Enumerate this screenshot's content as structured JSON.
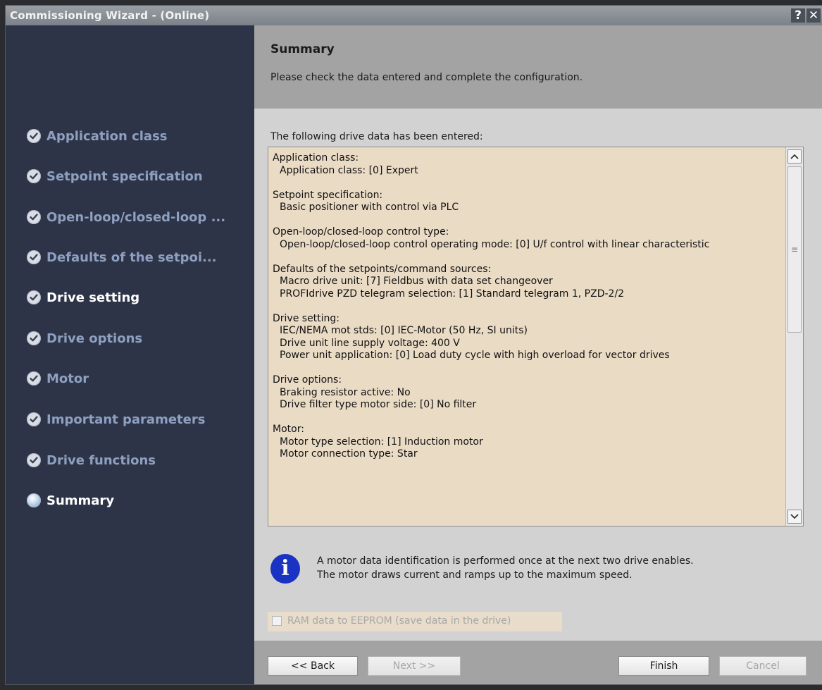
{
  "window": {
    "title": "Commissioning Wizard - (Online)",
    "help_label": "?",
    "close_label": "✕"
  },
  "sidebar": {
    "items": [
      {
        "label": "Application class",
        "state": "done"
      },
      {
        "label": "Setpoint specification",
        "state": "done"
      },
      {
        "label": "Open-loop/closed-loop ...",
        "state": "done"
      },
      {
        "label": "Defaults of the setpoi...",
        "state": "done"
      },
      {
        "label": "Drive setting",
        "state": "done-active"
      },
      {
        "label": "Drive options",
        "state": "done"
      },
      {
        "label": "Motor",
        "state": "done"
      },
      {
        "label": "Important parameters",
        "state": "done"
      },
      {
        "label": "Drive functions",
        "state": "done"
      },
      {
        "label": "Summary",
        "state": "current"
      }
    ]
  },
  "header": {
    "title": "Summary",
    "description": "Please check the data entered and complete the configuration."
  },
  "main": {
    "intro": "The following drive data has been entered:",
    "summary": [
      {
        "heading": "Application class:",
        "lines": [
          "Application class: [0] Expert"
        ]
      },
      {
        "heading": "Setpoint specification:",
        "lines": [
          "Basic positioner with control via PLC"
        ]
      },
      {
        "heading": "Open-loop/closed-loop control type:",
        "lines": [
          "Open-loop/closed-loop control operating mode: [0] U/f control with linear characteristic"
        ]
      },
      {
        "heading": "Defaults of the setpoints/command sources:",
        "lines": [
          "Macro drive unit: [7] Fieldbus with data set changeover",
          "PROFIdrive PZD telegram selection: [1] Standard telegram 1, PZD-2/2"
        ]
      },
      {
        "heading": "Drive setting:",
        "lines": [
          "IEC/NEMA mot stds: [0] IEC-Motor (50 Hz, SI units)",
          "Drive unit line supply voltage: 400 V",
          "Power unit application: [0] Load duty cycle with high overload for vector drives"
        ]
      },
      {
        "heading": "Drive options:",
        "lines": [
          "Braking resistor active: No",
          "Drive filter type motor side: [0] No filter"
        ]
      },
      {
        "heading": "Motor:",
        "lines": [
          "Motor type selection: [1] Induction motor",
          "Motor connection type: Star"
        ]
      }
    ],
    "info_line1": "A motor data identification is performed once at the next two drive enables.",
    "info_line2": "The motor draws current and ramps up to the maximum speed.",
    "ram_checkbox_label": "RAM data to EEPROM (save data in the drive)",
    "ram_checkbox_checked": false
  },
  "footer": {
    "back_label": "<< Back",
    "next_label": "Next >>",
    "finish_label": "Finish",
    "cancel_label": "Cancel"
  },
  "icons": {
    "done": "check-circle-icon",
    "current": "current-step-icon",
    "info": "info-icon"
  },
  "colors": {
    "sidebar_bg": "#2e3448",
    "sidebar_text": "#8ea0c0",
    "sidebar_active": "#ffffff",
    "summary_bg": "#eadbc5",
    "info_blue": "#1a33c2"
  }
}
